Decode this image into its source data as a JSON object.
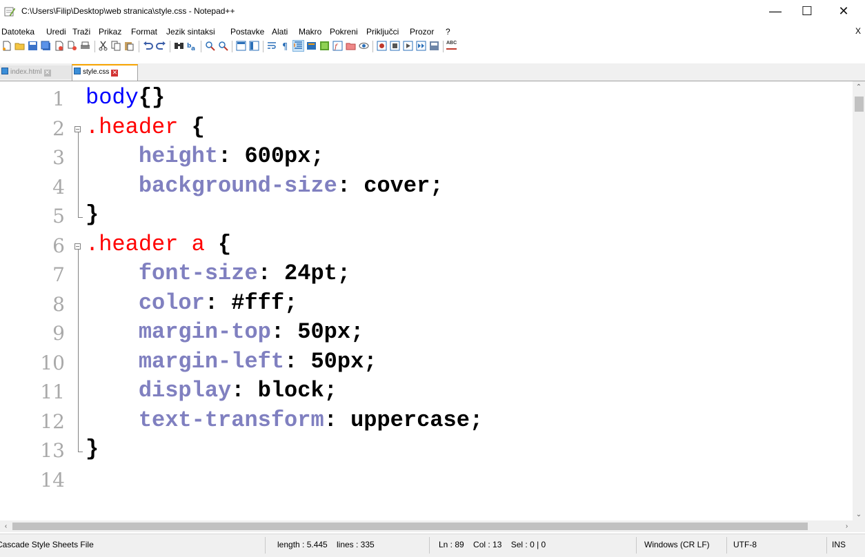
{
  "window": {
    "title": "C:\\Users\\Filip\\Desktop\\web stranica\\style.css - Notepad++",
    "minimize_glyph": "—",
    "maximize_glyph": "☐",
    "close_glyph": "✕"
  },
  "menu": {
    "items": [
      "Datoteka",
      "Uredi",
      "Traži",
      "Prikaz",
      "Format",
      "Jezik sintaksi",
      "Postavke",
      "Alati",
      "Makro",
      "Pokreni",
      "Priključci",
      "Prozor",
      "?"
    ],
    "close_label": "X"
  },
  "toolbar": {
    "icons": [
      "new-file-icon",
      "open-file-icon",
      "save-icon",
      "save-all-icon",
      "close-icon",
      "close-all-icon",
      "print-icon",
      "cut-icon",
      "copy-icon",
      "paste-icon",
      "undo-icon",
      "redo-icon",
      "find-icon",
      "replace-icon",
      "zoom-in-icon",
      "zoom-out-icon",
      "sync-vertical-icon",
      "sync-horizontal-icon",
      "word-wrap-icon",
      "show-all-characters-icon",
      "indent-guide-icon",
      "user-defined-language-icon",
      "document-map-icon",
      "function-list-icon",
      "folder-as-workspace-icon",
      "monitoring-icon",
      "record-macro-icon",
      "stop-recording-icon",
      "playback-icon",
      "run-macro-multiple-icon",
      "save-macro-icon",
      "spell-check-icon"
    ],
    "spell_check_label": "ABC"
  },
  "tabs": [
    {
      "label": "index.html",
      "active": false
    },
    {
      "label": "style.css",
      "active": true
    }
  ],
  "editor": {
    "lines": [
      {
        "num": "1",
        "tokens": [
          {
            "t": "body",
            "k": "tag"
          },
          {
            "t": "{}",
            "k": "brace"
          }
        ]
      },
      {
        "num": "2",
        "tokens": [
          {
            "t": ".header",
            "k": "cls"
          },
          {
            "t": " ",
            "k": "val"
          },
          {
            "t": "{",
            "k": "brace"
          }
        ]
      },
      {
        "num": "3",
        "tokens": [
          {
            "t": "    height",
            "k": "prop"
          },
          {
            "t": ": 600px;",
            "k": "val"
          }
        ]
      },
      {
        "num": "4",
        "tokens": [
          {
            "t": "    background-size",
            "k": "prop"
          },
          {
            "t": ": cover;",
            "k": "val"
          }
        ]
      },
      {
        "num": "5",
        "tokens": [
          {
            "t": "}",
            "k": "brace"
          }
        ]
      },
      {
        "num": "6",
        "tokens": [
          {
            "t": ".header a",
            "k": "cls"
          },
          {
            "t": " ",
            "k": "val"
          },
          {
            "t": "{",
            "k": "brace"
          }
        ]
      },
      {
        "num": "7",
        "tokens": [
          {
            "t": "    font-size",
            "k": "prop"
          },
          {
            "t": ": 24pt;",
            "k": "val"
          }
        ]
      },
      {
        "num": "8",
        "tokens": [
          {
            "t": "    color",
            "k": "prop"
          },
          {
            "t": ": #fff;",
            "k": "val"
          }
        ]
      },
      {
        "num": "9",
        "tokens": [
          {
            "t": "    margin-top",
            "k": "prop"
          },
          {
            "t": ": 50px;",
            "k": "val"
          }
        ]
      },
      {
        "num": "10",
        "tokens": [
          {
            "t": "    margin-left",
            "k": "prop"
          },
          {
            "t": ": 50px;",
            "k": "val"
          }
        ]
      },
      {
        "num": "11",
        "tokens": [
          {
            "t": "    display",
            "k": "prop"
          },
          {
            "t": ": block;",
            "k": "val"
          }
        ]
      },
      {
        "num": "12",
        "tokens": [
          {
            "t": "    text-transform",
            "k": "prop"
          },
          {
            "t": ": uppercase;",
            "k": "val"
          }
        ]
      },
      {
        "num": "13",
        "tokens": [
          {
            "t": "}",
            "k": "brace"
          }
        ]
      },
      {
        "num": "14",
        "tokens": []
      }
    ]
  },
  "status": {
    "file_type": "Cascade Style Sheets File",
    "length": "length : 5.445",
    "lines": "lines : 335",
    "position": "Ln : 89    Col : 13    Sel : 0 | 0",
    "eol": "Windows (CR LF)",
    "encoding": "UTF-8",
    "mode": "INS"
  },
  "colors": {
    "tag": "#0000ff",
    "class_selector": "#ff0000",
    "property": "#8080c0",
    "value": "#000000",
    "line_number": "#a9a9a9",
    "active_tab_accent": "#f8a400"
  }
}
